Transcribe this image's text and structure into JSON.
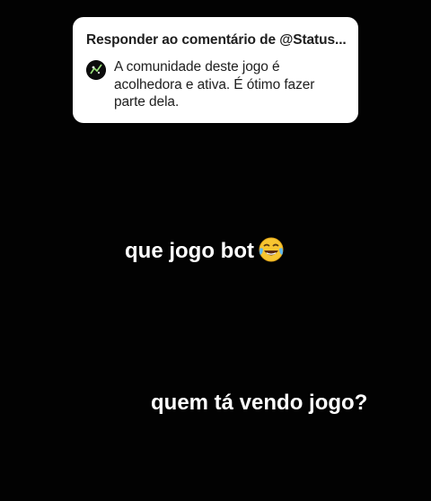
{
  "reply_card": {
    "header": "Responder ao comentário de @Status...",
    "comment": "A comunidade deste jogo é acolhedora e ativa. É  ótimo fazer parte dela.",
    "avatar_icon": "user-avatar-icon"
  },
  "captions": {
    "first": "que jogo bot",
    "first_emoji": "tears-of-joy-emoji",
    "second": "quem tá vendo jogo?"
  },
  "colors": {
    "background": "#020202",
    "card": "#ffffff",
    "card_text": "#1e1e1e",
    "caption_text": "#ffffff"
  }
}
